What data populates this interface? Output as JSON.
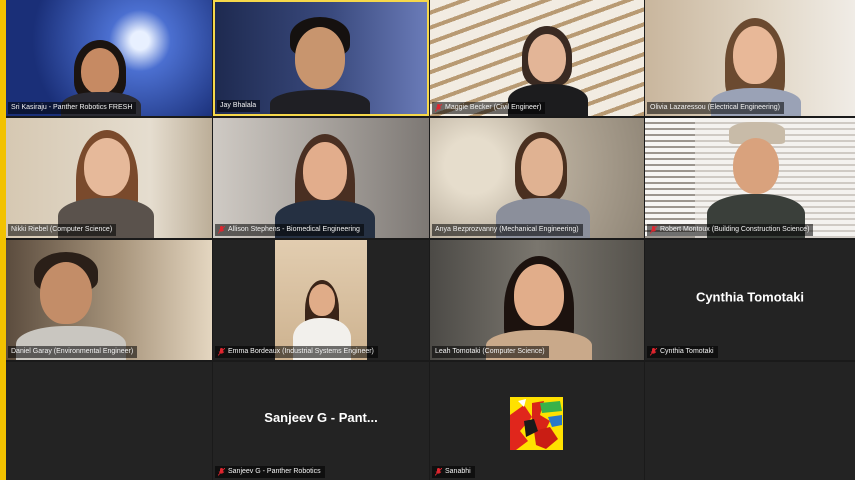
{
  "meeting": {
    "participants": [
      {
        "name": "Sri Kasiraju - Panther Robotics FRESH",
        "muted": false,
        "speaking": false
      },
      {
        "name": "Jay Bhalala",
        "muted": false,
        "speaking": true
      },
      {
        "name": "Maggie Becker (Civil Engineer)",
        "muted": true,
        "speaking": false
      },
      {
        "name": "Olivia Lazaressou (Electrical Engineering)",
        "muted": false,
        "speaking": false
      },
      {
        "name": "Nikki Riebel (Computer Science)",
        "muted": false,
        "speaking": false
      },
      {
        "name": "Allison Stephens - Biomedical Engineering",
        "muted": true,
        "speaking": false
      },
      {
        "name": "Anya Bezprozvanny (Mechanical Engineering)",
        "muted": false,
        "speaking": false
      },
      {
        "name": "Robert Montoux (Building Construction Science)",
        "muted": true,
        "speaking": false
      },
      {
        "name": "Daniel Garay (Environmental Engineer)",
        "muted": false,
        "speaking": false
      },
      {
        "name": "Emma Bordeaux (Industrial Systems Engineer)",
        "muted": true,
        "speaking": false
      },
      {
        "name": "Leah Tomotaki (Computer Science)",
        "muted": false,
        "speaking": false
      },
      {
        "name": "Cynthia Tomotaki",
        "display": "Cynthia Tomotaki",
        "muted": true,
        "speaking": false
      },
      {
        "name": "Sanjeev G - Panther Robotics",
        "display": "Sanjeev G  - Pant...",
        "muted": true,
        "speaking": false
      },
      {
        "name": "Sanabhi",
        "muted": true,
        "speaking": false
      }
    ]
  },
  "colors": {
    "accent": "#f2c200",
    "speaking_border": "#f6d84a",
    "muted_icon": "#e0262f",
    "tile_bg": "#232323"
  }
}
